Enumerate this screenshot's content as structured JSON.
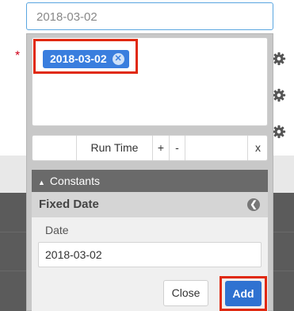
{
  "top_input": {
    "value": "2018-03-02"
  },
  "required_marker": "*",
  "selected_value": {
    "label": "2018-03-02",
    "remove_icon": "close-circle-icon"
  },
  "toolbar": {
    "run_time_label": "Run Time",
    "plus_label": "+",
    "minus_label": "-",
    "clear_label": "x"
  },
  "constants": {
    "header_label": "Constants",
    "collapse_icon": "triangle-up-icon",
    "fixed_date": {
      "title": "Fixed Date",
      "back_icon": "arrow-left-circle-icon",
      "field_label": "Date",
      "field_value": "2018-03-02"
    }
  },
  "actions": {
    "close_label": "Close",
    "add_label": "Add"
  },
  "colors": {
    "accent": "#3a7ede",
    "highlight": "#e0290f",
    "required": "#d0021b"
  },
  "side_icons": [
    "gear-icon",
    "gear-icon",
    "gear-icon"
  ]
}
